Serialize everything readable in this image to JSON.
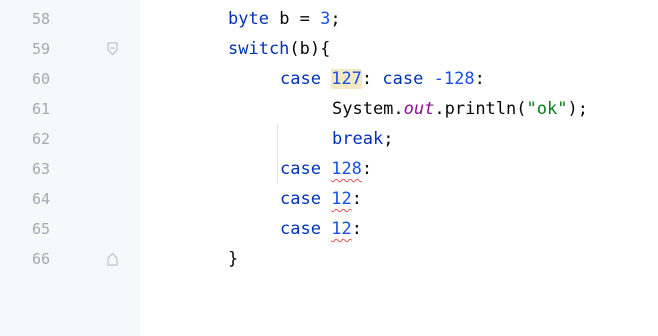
{
  "gutter": {
    "line_numbers": [
      "58",
      "59",
      "60",
      "61",
      "62",
      "63",
      "64",
      "65",
      "66"
    ]
  },
  "code": {
    "line58": {
      "keyword": "byte",
      "text": " b = ",
      "number": "3",
      "end": ";"
    },
    "line59": {
      "keyword": "switch",
      "text": "(b){"
    },
    "line60": {
      "keyword1": "case",
      "number1": "127",
      "sep": ": ",
      "keyword2": "case",
      "number2": "-128",
      "end": ":"
    },
    "line61": {
      "prefix": "System.",
      "field": "out",
      "method": ".println(",
      "string": "\"ok\"",
      "end": ");"
    },
    "line62": {
      "keyword": "break",
      "end": ";"
    },
    "line63": {
      "keyword": "case",
      "number": "128",
      "end": ":"
    },
    "line64": {
      "keyword": "case",
      "number": "12",
      "end": ":"
    },
    "line65": {
      "keyword": "case",
      "number": "12",
      "end": ":"
    },
    "line66": {
      "text": "}"
    }
  },
  "icons": {
    "fold_open": "fold-open-icon",
    "fold_close": "fold-close-icon"
  },
  "colors": {
    "keyword": "#0033b3",
    "number": "#1750eb",
    "string": "#067d17",
    "field": "#871094",
    "highlight": "#f5e9c3",
    "error_underline": "#e05050"
  }
}
